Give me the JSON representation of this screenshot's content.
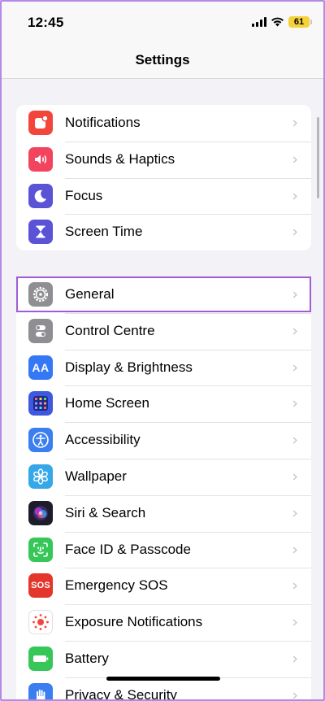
{
  "status_bar": {
    "time": "12:45",
    "battery_level": "61"
  },
  "nav": {
    "title": "Settings"
  },
  "group1": [
    {
      "label": "Notifications",
      "icon": "notifications-icon",
      "color": "#f2463d"
    },
    {
      "label": "Sounds & Haptics",
      "icon": "sounds-icon",
      "color": "#f2445f"
    },
    {
      "label": "Focus",
      "icon": "moon-icon",
      "color": "#5a53d6"
    },
    {
      "label": "Screen Time",
      "icon": "hourglass-icon",
      "color": "#5a53d6"
    }
  ],
  "group2": [
    {
      "label": "General",
      "icon": "gear-icon",
      "color": "#8e8e93",
      "highlighted": true
    },
    {
      "label": "Control Centre",
      "icon": "toggles-icon",
      "color": "#8e8e93"
    },
    {
      "label": "Display & Brightness",
      "icon": "text-size-icon",
      "text": "AA",
      "color": "#3478f6"
    },
    {
      "label": "Home Screen",
      "icon": "app-grid-icon",
      "color": "#3f58e0"
    },
    {
      "label": "Accessibility",
      "icon": "accessibility-icon",
      "color": "#3a7ef0"
    },
    {
      "label": "Wallpaper",
      "icon": "flower-icon",
      "color": "#36a7e8"
    },
    {
      "label": "Siri & Search",
      "icon": "siri-icon",
      "color": "#1c1c2a"
    },
    {
      "label": "Face ID & Passcode",
      "icon": "face-id-icon",
      "color": "#37c759"
    },
    {
      "label": "Emergency SOS",
      "icon": "sos-icon",
      "text": "SOS",
      "color": "#e3372d"
    },
    {
      "label": "Exposure Notifications",
      "icon": "exposure-icon",
      "color": "#ffffff"
    },
    {
      "label": "Battery",
      "icon": "battery-icon",
      "color": "#37c759"
    },
    {
      "label": "Privacy & Security",
      "icon": "hand-icon",
      "color": "#3a7ef0"
    }
  ]
}
